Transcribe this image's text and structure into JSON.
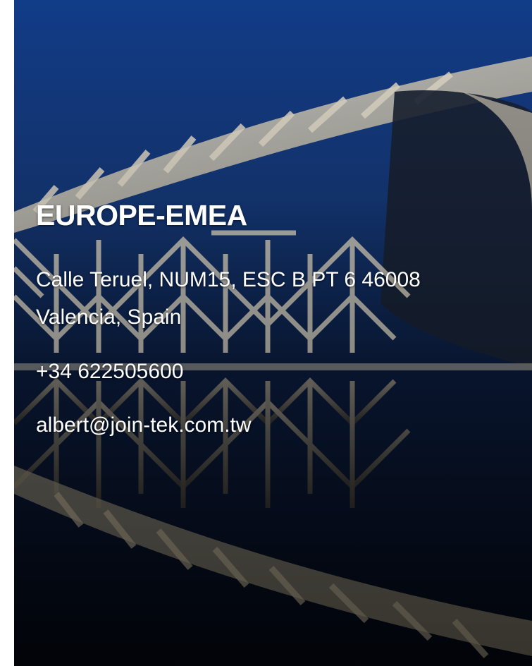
{
  "office": {
    "region": "EUROPE-EMEA",
    "address_line_1": "Calle Teruel, NUM15, ESC B PT 6 46008",
    "address_line_2": "Valencia, Spain",
    "phone": "+34 622505600",
    "email": "albert@join-tek.com.tw"
  },
  "background": {
    "description_icon": "architecture-photo",
    "sky_color": "#0f3a86",
    "structure_color": "#e9e3d3",
    "shadow_color": "#040814"
  }
}
